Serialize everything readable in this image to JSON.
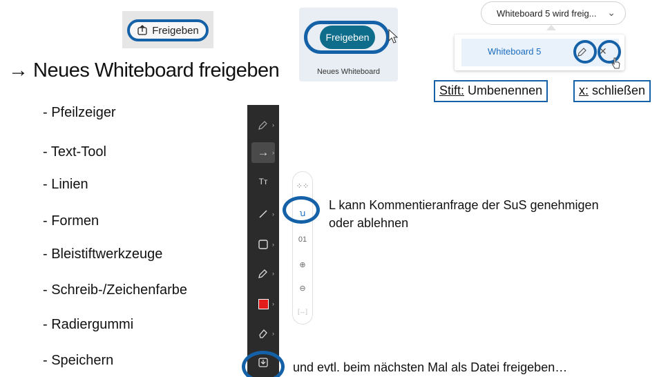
{
  "share_button": {
    "label": "Freigeben"
  },
  "new_whiteboard_tile": {
    "button_label": "Freigeben",
    "caption": "Neues Whiteboard"
  },
  "dropdown": {
    "label": "Whiteboard 5 wird freig..."
  },
  "whiteboard_item": {
    "label": "Whiteboard 5"
  },
  "labels": {
    "pen_key": "Stift:",
    "pen_text": "Umbenennen",
    "x_key": "x:",
    "x_text": "schließen"
  },
  "heading": "→ Neues Whiteboard freigeben",
  "tools_list": [
    "- Pfeilzeiger",
    "- Text-Tool",
    "- Linien",
    "- Formen",
    "- Bleistiftwerkzeuge",
    "- Schreib-/Zeichenfarbe",
    "- Radiergummi",
    "- Speichern"
  ],
  "toolbar_icons": [
    "pencil-arrow-icon",
    "arrow-pointer-icon",
    "text-tool-icon",
    "line-icon",
    "shape-icon",
    "pencil-icon",
    "color-swatch-icon",
    "eraser-icon",
    "save-icon"
  ],
  "palette": {
    "counter": "01"
  },
  "note_comment_line1": "L kann Kommentieranfrage der SuS genehmigen",
  "note_comment_line2": "oder ablehnen",
  "note_save": "und evtl. beim nächsten Mal als Datei freigeben…",
  "colors": {
    "accent_ring": "#1561a8",
    "teal_button": "#0f6d8c",
    "toolbar_bg": "#2b2b2b",
    "swatch_red": "#e21b1b"
  }
}
